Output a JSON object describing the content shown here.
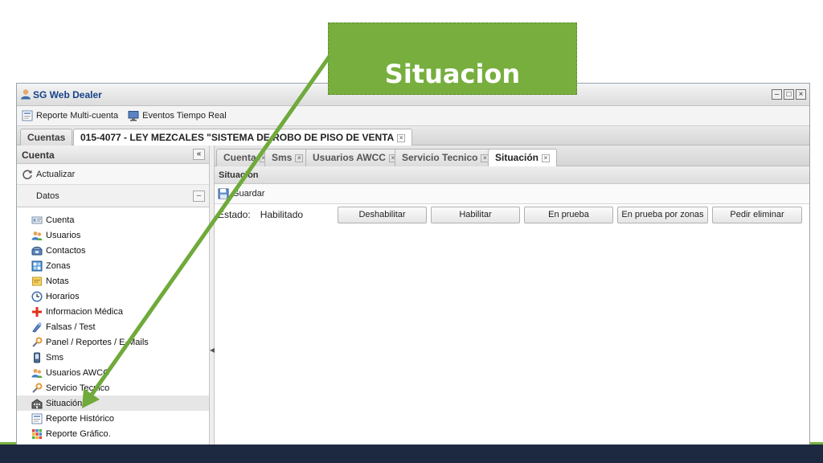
{
  "window": {
    "title": "SG Web Dealer",
    "minimize": "–",
    "maximize": "□",
    "close": "×"
  },
  "toolbar": {
    "items": [
      {
        "label": "Reporte Multi-cuenta",
        "icon": "report-icon"
      },
      {
        "label": "Eventos Tiempo Real",
        "icon": "monitor-icon"
      }
    ]
  },
  "account_tabs": [
    {
      "label": "Cuentas"
    },
    {
      "label": "015-4077 - LEY MEZCALES \"SISTEMA DE ROBO DE PISO DE VENTA"
    }
  ],
  "sidebar": {
    "header": "Cuenta",
    "collapse": "«",
    "refresh_label": "Actualizar",
    "section_label": "Datos",
    "section_toggle": "–",
    "items": [
      {
        "label": "Cuenta",
        "icon": "id-card-icon"
      },
      {
        "label": "Usuarios",
        "icon": "users-icon"
      },
      {
        "label": "Contactos",
        "icon": "phone-icon"
      },
      {
        "label": "Zonas",
        "icon": "zones-icon"
      },
      {
        "label": "Notas",
        "icon": "notes-icon"
      },
      {
        "label": "Horarios",
        "icon": "clock-icon"
      },
      {
        "label": "Informacion Médica",
        "icon": "medical-icon"
      },
      {
        "label": "Falsas / Test",
        "icon": "test-icon"
      },
      {
        "label": "Panel / Reportes / E-Mails",
        "icon": "wrench-icon"
      },
      {
        "label": "Sms",
        "icon": "mobile-icon"
      },
      {
        "label": "Usuarios AWCC",
        "icon": "users-icon"
      },
      {
        "label": "Servicio Tecnico",
        "icon": "wrench-icon"
      },
      {
        "label": "Situación",
        "icon": "building-icon"
      },
      {
        "label": "Reporte Histórico",
        "icon": "report-icon"
      },
      {
        "label": "Reporte Gráfico.",
        "icon": "chart-icon"
      }
    ]
  },
  "inner_tabs": [
    {
      "label": "Cuenta"
    },
    {
      "label": "Sms"
    },
    {
      "label": "Usuarios AWCC"
    },
    {
      "label": "Servicio Tecnico"
    },
    {
      "label": "Situación"
    }
  ],
  "panel": {
    "title": "Situacion",
    "save_label": "Guardar",
    "estado_label": "Estado:",
    "estado_value": "Habilitado",
    "buttons": [
      "Deshabilitar",
      "Habilitar",
      "En prueba",
      "En prueba por zonas",
      "Pedir eliminar"
    ]
  },
  "callout": {
    "text": "Situacion"
  },
  "colors": {
    "callout_green": "#77ae3e",
    "arrow_green": "#6faa3a",
    "footer_navy": "#1d2940"
  }
}
